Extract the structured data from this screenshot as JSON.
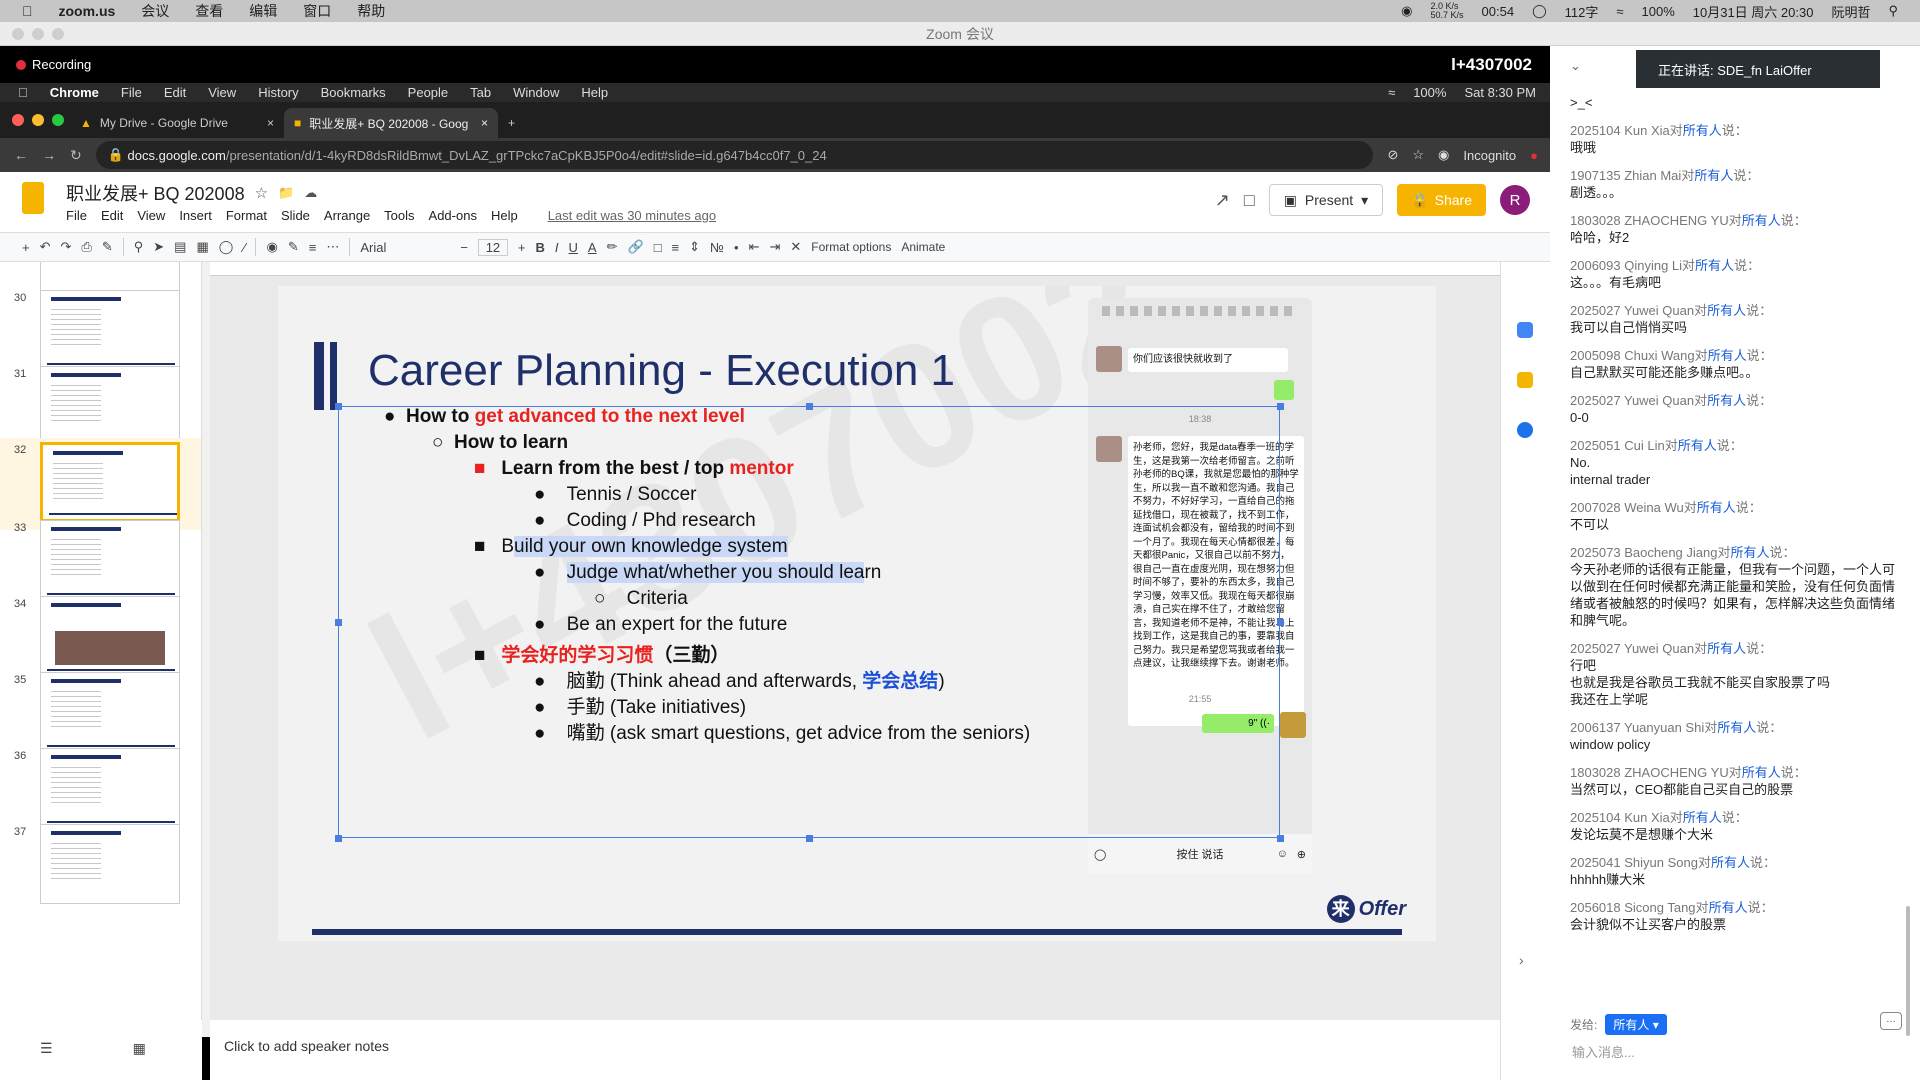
{
  "macbar": {
    "app": "zoom.us",
    "menus": [
      "会议",
      "查看",
      "编辑",
      "窗口",
      "帮助"
    ],
    "net_up": "2.0 K/s",
    "net_down": "50.7 K/s",
    "timer": "00:54",
    "wifi_strength": "112字",
    "battery": "100%",
    "datetime": "10月31日 周六 20:30",
    "user": "阮明哲"
  },
  "zoom": {
    "window_title": "Zoom 会议",
    "recording_label": "Recording",
    "meeting_id": "l+4307002"
  },
  "inner": {
    "mac_app": "Chrome",
    "mac_menus": [
      "File",
      "Edit",
      "View",
      "History",
      "Bookmarks",
      "People",
      "Tab",
      "Window",
      "Help"
    ],
    "battery": "100%",
    "clock": "Sat 8:30 PM",
    "tabs": [
      {
        "label": "My Drive - Google Drive",
        "close": "×"
      },
      {
        "label": "职业发展+ BQ 202008 - Goog",
        "close": "×"
      }
    ],
    "new_tab": "+",
    "url_host": "docs.google.com",
    "url_path": "/presentation/d/1-4kyRD8dsRildBmwt_DvLAZ_grTPckc7aCpKBJ5P0o4/edit#slide=id.g647b4cc0f7_0_24",
    "incognito": "Incognito"
  },
  "doc": {
    "title": "职业发展+ BQ 202008",
    "menus": [
      "File",
      "Edit",
      "View",
      "Insert",
      "Format",
      "Slide",
      "Arrange",
      "Tools",
      "Add-ons",
      "Help"
    ],
    "last_edit": "Last edit was 30 minutes ago",
    "present": "Present",
    "share": "Share",
    "avatar": "R",
    "font": "Arial",
    "font_size": "12",
    "format_options": "Format options",
    "animate": "Animate",
    "notes_placeholder": "Click to add speaker notes"
  },
  "filmstrip": {
    "numbers": [
      "30",
      "31",
      "32",
      "33",
      "34",
      "35",
      "36",
      "37"
    ],
    "selected": "32"
  },
  "slide": {
    "title": "Career Planning - Execution 1",
    "b1a": "How to ",
    "b1b": "get advanced to the next level",
    "b2": "How to learn",
    "b3a": "Learn from the best / top ",
    "b3b": "mentor",
    "b4": "Tennis / Soccer",
    "b5": "Coding / Phd research",
    "b6a": "B",
    "b6b": "uild your own knowledge system",
    "b7a": "Judge what/whether you should lea",
    "b7b": "rn",
    "b8": "Criteria",
    "b9": "Be an expert for the future",
    "b10a": "学会好的学习习惯",
    "b10b": "（三勤）",
    "b11a": "脑勤 (Think ahead and afterwards, ",
    "b11b": "学会总结",
    "b11c": ")",
    "b12": "手勤 (Take initiatives)",
    "b13": "嘴勤 (ask smart questions, get advice from the seniors)",
    "logo_mark": "来",
    "logo_text": "Offer"
  },
  "phone": {
    "msg1": "你们应该很快就收到了",
    "time1": "18:38",
    "msg2": "孙老师，您好，我是data春季一班的学生，这是我第一次给老师留言。之前听孙老师的BQ课，我就是您最怕的那种学生，所以我一直不敢和您沟通。我自己不努力，不好好学习，一直给自己的拖延找借口，现在被裁了，找不到工作，连面试机会都没有，留给我的时间不到一个月了。我现在每天心情都很差，每天都很Panic，又很自己以前不努力，很自己一直在虚度光阴，现在想努力但时间不够了，要补的东西太多，我自己学习慢，效率又低。我现在每天都很崩溃，自己实在撑不住了，才敢给您留言，我知道老师不是神，不能让我马上找到工作，这是我自己的事，要靠我自己努力。我只是希望您骂我或者给我一点建议，让我继续撑下去。谢谢老师。",
    "time2": "21:55",
    "voice": "9\" ((·",
    "hold_to_talk": "按住 说话"
  },
  "chat": {
    "speaking": "正在讲话: SDE_fn LaiOffer",
    "to_label": "对",
    "everyone": "所有人",
    "said": "说：",
    "messages": [
      {
        "from": "",
        "text": ">_<"
      },
      {
        "from": "2025104 Kun Xia",
        "text": "哦哦"
      },
      {
        "from": "1907135 Zhian Mai",
        "text": "剧透。。。"
      },
      {
        "from": "1803028 ZHAOCHENG YU",
        "text": "哈哈，好2"
      },
      {
        "from": "2006093 Qinying Li",
        "text": "这。。。有毛病吧"
      },
      {
        "from": "2025027 Yuwei Quan",
        "text": "我可以自己悄悄买吗"
      },
      {
        "from": "2005098 Chuxi Wang",
        "text": "自己默默买可能还能多赚点吧。。"
      },
      {
        "from": "2025027 Yuwei Quan",
        "text": "0-0"
      },
      {
        "from": "2025051 Cui Lin",
        "text": "No.\ninternal trader"
      },
      {
        "from": "2007028 Weina Wu",
        "text": "不可以"
      },
      {
        "from": "2025073 Baocheng Jiang",
        "text": "今天孙老师的话很有正能量，但我有一个问题，一个人可以做到在任何时候都充满正能量和笑脸，没有任何负面情绪或者被触怒的时候吗？如果有，怎样解决这些负面情绪和脾气呢。"
      },
      {
        "from": "2025027 Yuwei Quan",
        "text": "行吧\n也就是我是谷歌员工我就不能买自家股票了吗\n我还在上学呢"
      },
      {
        "from": "2006137 Yuanyuan Shi",
        "text": "window policy"
      },
      {
        "from": "1803028 ZHAOCHENG YU",
        "text": "当然可以，CEO都能自己买自己的股票"
      },
      {
        "from": "2025104 Kun Xia",
        "text": "发论坛莫不是想赚个大米"
      },
      {
        "from": "2025041 Shiyun Song",
        "text": "hhhhh赚大米"
      },
      {
        "from": "2056018 Sicong Tang",
        "text": "会计貌似不让买客户的股票"
      }
    ],
    "send_to": "发给:",
    "send_target": "所有人",
    "input_placeholder": "输入消息..."
  }
}
